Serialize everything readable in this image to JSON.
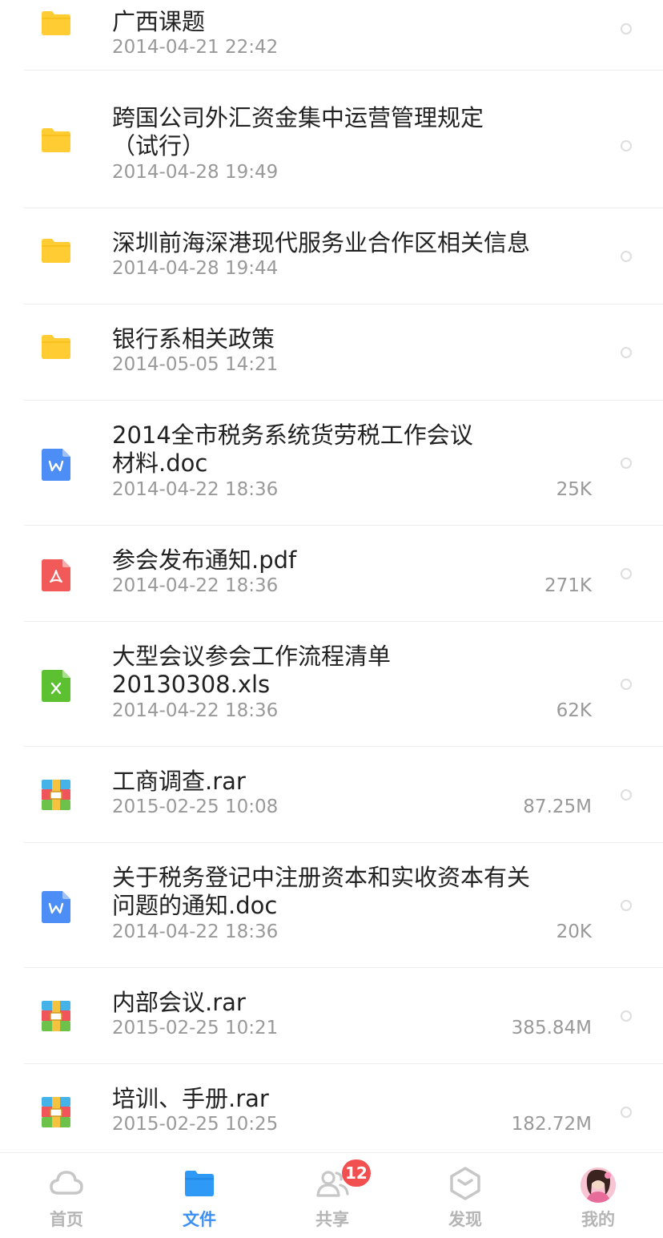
{
  "files": [
    {
      "type": "folder",
      "name": "广西课题",
      "date": "2014-04-21 22:42",
      "size": ""
    },
    {
      "type": "folder",
      "name": "跨国公司外汇资金集中运营管理规定\n（试行）",
      "date": "2014-04-28 19:49",
      "size": ""
    },
    {
      "type": "folder",
      "name": "深圳前海深港现代服务业合作区相关信息",
      "date": "2014-04-28 19:44",
      "size": ""
    },
    {
      "type": "folder",
      "name": "银行系相关政策",
      "date": "2014-05-05 14:21",
      "size": ""
    },
    {
      "type": "doc",
      "name": "2014全市税务系统货劳税工作会议\n材料.doc",
      "date": "2014-04-22 18:36",
      "size": "25K"
    },
    {
      "type": "pdf",
      "name": "参会发布通知.pdf",
      "date": "2014-04-22 18:36",
      "size": "271K"
    },
    {
      "type": "xls",
      "name": "大型会议参会工作流程清单\n20130308.xls",
      "date": "2014-04-22 18:36",
      "size": "62K"
    },
    {
      "type": "rar",
      "name": "工商调查.rar",
      "date": "2015-02-25 10:08",
      "size": "87.25M"
    },
    {
      "type": "doc",
      "name": "关于税务登记中注册资本和实收资本有关\n问题的通知.doc",
      "date": "2014-04-22 18:36",
      "size": "20K"
    },
    {
      "type": "rar",
      "name": "内部会议.rar",
      "date": "2015-02-25 10:21",
      "size": "385.84M"
    },
    {
      "type": "rar",
      "name": "培训、手册.rar",
      "date": "2015-02-25 10:25",
      "size": "182.72M"
    }
  ],
  "icons": {
    "folder": "folder-icon",
    "doc": "word-doc-icon",
    "pdf": "pdf-icon",
    "xls": "excel-icon",
    "rar": "rar-archive-icon"
  },
  "tabs": [
    {
      "label": "首页",
      "icon": "cloud-icon",
      "active": false
    },
    {
      "label": "文件",
      "icon": "folder-tab-icon",
      "active": true
    },
    {
      "label": "共享",
      "icon": "share-people-icon",
      "active": false,
      "badge": "12"
    },
    {
      "label": "发现",
      "icon": "discover-hexagon-icon",
      "active": false
    },
    {
      "label": "我的",
      "icon": "avatar",
      "active": false
    }
  ],
  "colors": {
    "accent": "#3a8ff5",
    "folder": "#ffcc33",
    "badge": "#f25050"
  }
}
